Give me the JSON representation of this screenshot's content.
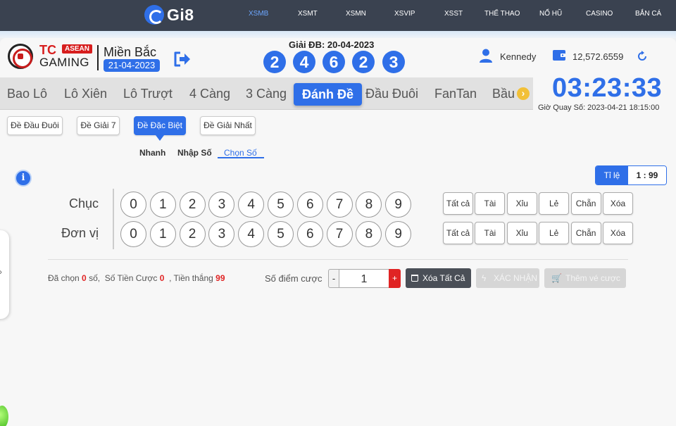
{
  "topnav": {
    "brand": "Gi8",
    "items": [
      {
        "label": "XSMB",
        "active": true
      },
      {
        "label": "XSMT"
      },
      {
        "label": "XSMN"
      },
      {
        "label": "XSVIP"
      },
      {
        "label": "XSST"
      },
      {
        "label": "THỂ THAO"
      },
      {
        "label": "NỔ HŨ"
      },
      {
        "label": "CASINO"
      },
      {
        "label": "BẮN CÁ"
      }
    ]
  },
  "header": {
    "logo": {
      "tc": "TC",
      "asean": "ASEAN",
      "gaming": "GAMING"
    },
    "region": "Miền Bắc",
    "region_date": "21-04-2023",
    "result_title": "Giải ĐB: 20-04-2023",
    "result_digits": [
      "2",
      "4",
      "6",
      "2",
      "3"
    ],
    "username": "Kennedy",
    "balance": "12,572.6559",
    "clock": "03:23:33",
    "draw_time": "Giờ Quay Số: 2023-04-21 18:15:00"
  },
  "tabs": [
    "Bao Lô",
    "Lô Xiên",
    "Lô Trượt",
    "4 Càng",
    "3 Càng",
    "Đánh Đề",
    "Đầu Đuôi",
    "FanTan",
    "Bầu"
  ],
  "active_tab": "Đánh Đề",
  "subtabs": [
    "Đề Đầu Đuôi",
    "Đề Giải 7",
    "Đề Đặc Biệt",
    "Đề Giải Nhất"
  ],
  "active_subtab": "Đề Đặc Biệt",
  "modes": [
    "Nhanh",
    "Nhập Số",
    "Chọn Số"
  ],
  "active_mode": "Chọn Số",
  "odds": {
    "label": "Tỉ lệ",
    "value": "1 : 99"
  },
  "rows": [
    {
      "label": "Chục",
      "numbers": [
        "0",
        "1",
        "2",
        "3",
        "4",
        "5",
        "6",
        "7",
        "8",
        "9"
      ]
    },
    {
      "label": "Đơn vị",
      "numbers": [
        "0",
        "1",
        "2",
        "3",
        "4",
        "5",
        "6",
        "7",
        "8",
        "9"
      ]
    }
  ],
  "quick_buttons": [
    "Tất cả",
    "Tài",
    "Xỉu",
    "Lẻ",
    "Chẵn",
    "Xóa"
  ],
  "summary": {
    "selected_prefix": "Đã chọn",
    "selected_count": "0",
    "selected_suffix": "số,",
    "money_label": "Số Tiền Cược",
    "money_value": "0",
    "win_label": ", Tiền thắng",
    "win_value": "99"
  },
  "bet": {
    "points_label": "Số điểm cược",
    "minus": "-",
    "value": "1",
    "plus": "+",
    "clear_all": "Xóa Tất Cả",
    "confirm": "XÁC NHẬN",
    "add_ticket": "Thêm vé cược"
  },
  "colors": {
    "accent": "#2f6fe8",
    "nav_bg": "#3a4250",
    "highlight_red": "#e02424"
  }
}
